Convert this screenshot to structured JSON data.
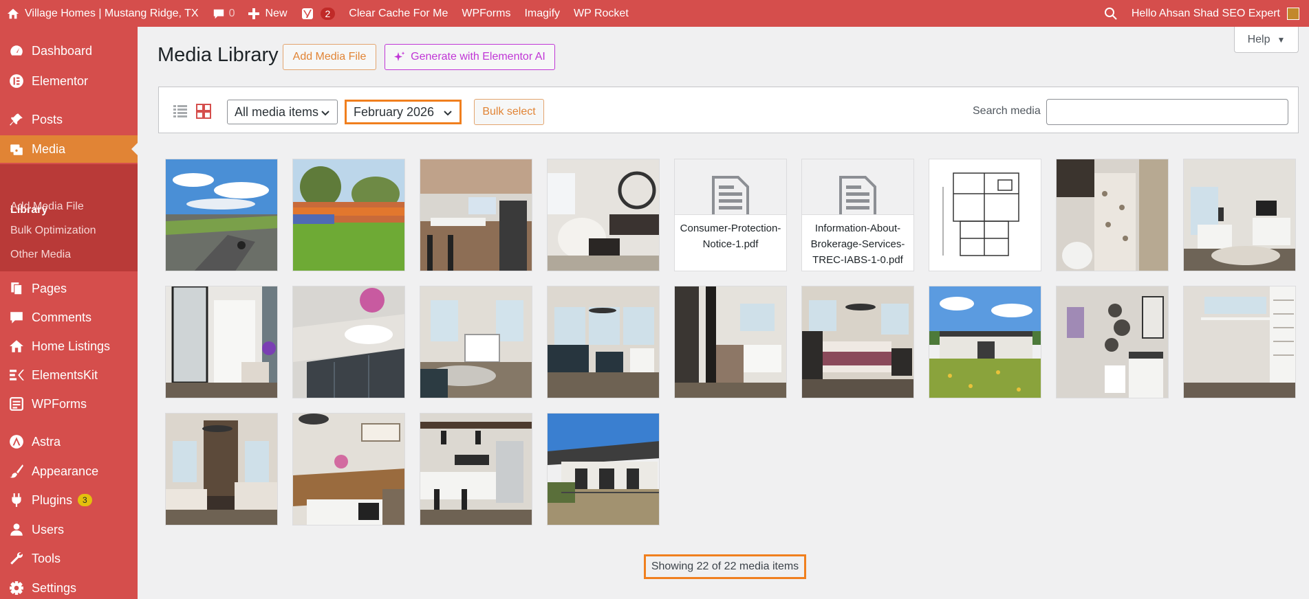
{
  "adminbar": {
    "site_name": "Village Homes | Mustang Ridge, TX",
    "comments_count": "0",
    "new_label": "New",
    "yoast_badge": "2",
    "clear_cache": "Clear Cache For Me",
    "wpforms": "WPForms",
    "imagify": "Imagify",
    "wp_rocket": "WP Rocket",
    "greeting": "Hello Ahsan Shad SEO Expert"
  },
  "sidebar": {
    "dashboard": "Dashboard",
    "elementor": "Elementor",
    "posts": "Posts",
    "media": "Media",
    "sub_library": "Library",
    "sub_add": "Add Media File",
    "sub_bulk": "Bulk Optimization",
    "sub_other": "Other Media",
    "pages": "Pages",
    "comments": "Comments",
    "home_listings": "Home Listings",
    "elementskit": "ElementsKit",
    "wpforms": "WPForms",
    "astra": "Astra",
    "appearance": "Appearance",
    "plugins": "Plugins",
    "plugins_badge": "3",
    "users": "Users",
    "tools": "Tools",
    "settings": "Settings"
  },
  "header": {
    "title": "Media Library",
    "add_media": "Add Media File",
    "generate_ai": "Generate with Elementor AI",
    "help": "Help"
  },
  "toolbar": {
    "type_filter": "All media items",
    "date_filter": "February 2026",
    "bulk_select": "Bulk select",
    "search_label": "Search media",
    "search_value": ""
  },
  "docs": {
    "doc1": "Consumer-Protection-Notice-1.pdf",
    "doc2": "Information-About-Brokerage-Services-TREC-IABS-1-0.pdf"
  },
  "footer": {
    "count": "Showing 22 of 22 media items"
  },
  "colors": {
    "admin_red": "#d54e4c",
    "active_orange": "#e18435",
    "highlight_orange": "#f07f1e",
    "elementor_ai": "#c036d6"
  }
}
